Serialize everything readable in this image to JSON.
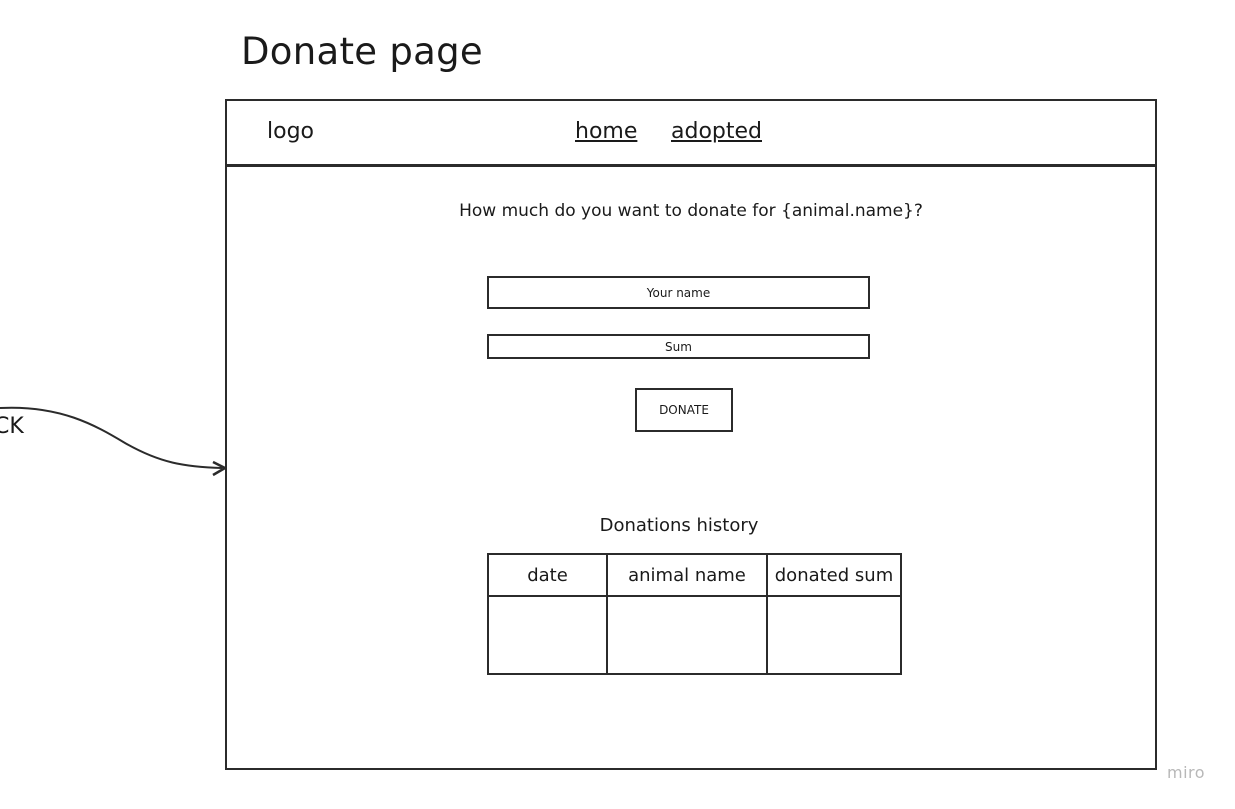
{
  "board": {
    "title": "Donate page",
    "flow_label": "CK",
    "watermark": "miro"
  },
  "navbar": {
    "logo": "logo",
    "links": [
      {
        "label": "home"
      },
      {
        "label": "adopted"
      }
    ]
  },
  "form": {
    "question": "How much do you want to donate for {animal.name}?",
    "name_placeholder": "Your name",
    "sum_placeholder": "Sum",
    "donate_label": "DONATE"
  },
  "history": {
    "title": "Donations history",
    "columns": [
      "date",
      "animal name",
      "donated sum"
    ],
    "rows": [
      [
        "",
        "",
        ""
      ]
    ]
  },
  "colors": {
    "stroke": "#2b2b2b",
    "text": "#1a1a1a",
    "watermark": "#b8b8b8",
    "background": "#ffffff"
  }
}
